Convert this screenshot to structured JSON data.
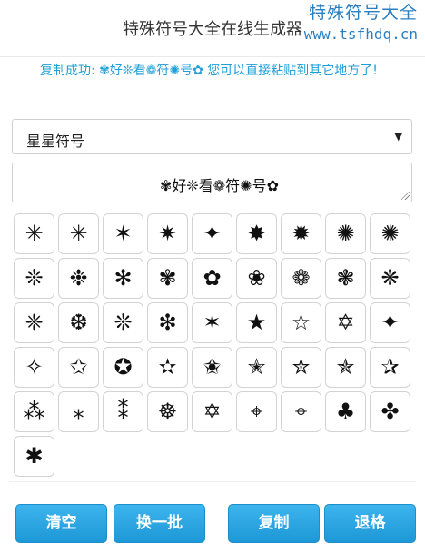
{
  "header": {
    "title": "特殊符号大全在线生成器"
  },
  "watermark": {
    "site_name": "特殊符号大全",
    "url": "www.tsfhdq.cn"
  },
  "status": {
    "message": "复制成功: ✾好❊看❁符✺号✿ 您可以直接粘贴到其它地方了!"
  },
  "category_select": {
    "selected": "星星符号",
    "arrow": "▼"
  },
  "output": {
    "value": "✾好❊看❁符✺号✿"
  },
  "symbols": [
    "✳",
    "✳",
    "✶",
    "✷",
    "✦",
    "✸",
    "✹",
    "✺",
    "✺",
    "❊",
    "❉",
    "✻",
    "✾",
    "✿",
    "❀",
    "❁",
    "❃",
    "❋",
    "❈",
    "❆",
    "❊",
    "❇",
    "✶",
    "★",
    "☆",
    "✡",
    "✦",
    "✧",
    "✩",
    "✪",
    "✫",
    "✬",
    "✭",
    "✮",
    "✯",
    "✰",
    "⁂",
    "⁎",
    "⁑",
    "☸",
    "✡",
    "⌖",
    "⌖",
    "♣",
    "✤",
    "✱"
  ],
  "buttons": {
    "clear": "清空",
    "refresh": "换一批",
    "copy": "复制",
    "backspace": "退格"
  }
}
